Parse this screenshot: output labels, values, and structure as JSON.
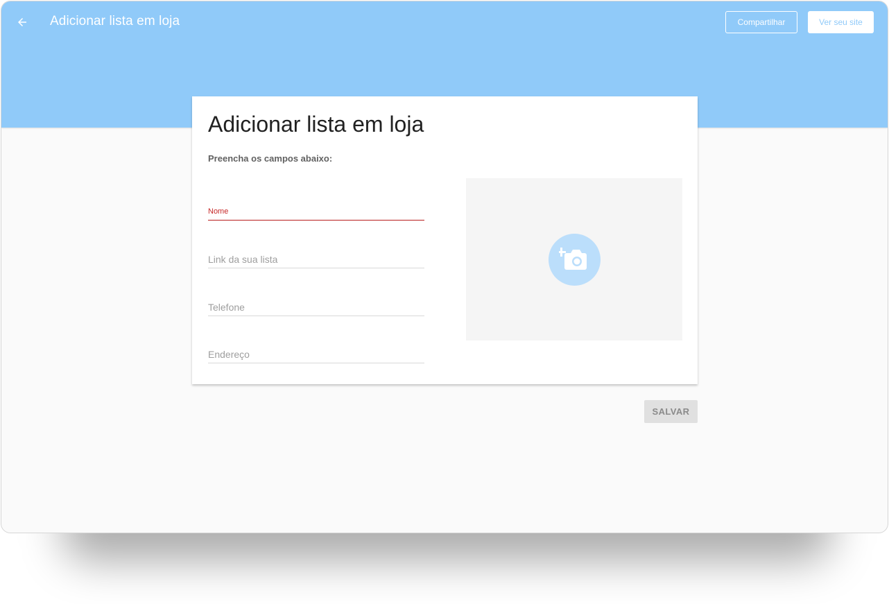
{
  "header": {
    "title": "Adicionar lista em loja",
    "share_label": "Compartilhar",
    "site_label": "Ver seu site"
  },
  "card": {
    "title": "Adicionar lista em loja",
    "subtitle": "Preencha os campos abaixo:",
    "fields": [
      {
        "label": "Nome",
        "value": "",
        "active": true
      },
      {
        "label": "Link da sua lista",
        "value": "",
        "active": false
      },
      {
        "label": "Telefone",
        "value": "",
        "active": false
      },
      {
        "label": "Endereço",
        "value": "",
        "active": false
      }
    ],
    "image_icon": "add-photo-icon"
  },
  "actions": {
    "save_label": "SALVAR"
  },
  "colors": {
    "header_bg": "#90caf9",
    "accent_active": "#b71c1c",
    "camera_circle": "#bbdefb"
  }
}
